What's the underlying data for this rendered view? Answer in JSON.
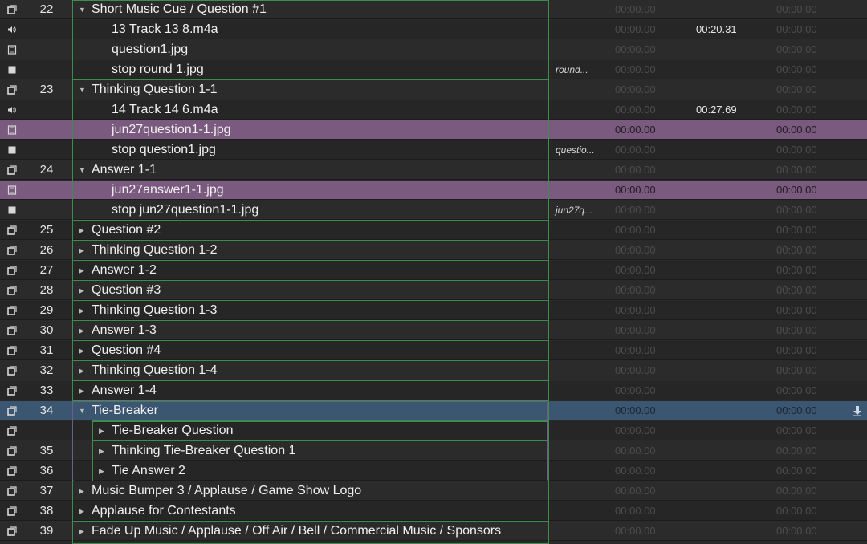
{
  "colors": {
    "row_bg_a": "#2b2b2b",
    "row_bg_b": "#262626",
    "row_purple": "#7a5a7e",
    "row_selected": "#3b5670",
    "group_outline": "#3f8a4c"
  },
  "rows": [
    {
      "icon": "group-icon",
      "num": "22",
      "name": "Short Music Cue / Question #1",
      "level": 0,
      "triangle": "expanded",
      "target": "",
      "t1": "00:00.00",
      "t2": "",
      "t3": "00:00.00",
      "state": ""
    },
    {
      "icon": "audio-icon",
      "num": "",
      "name": "13 Track 13 8.m4a",
      "level": 1,
      "triangle": "",
      "target": "",
      "t1": "00:00.00",
      "t2": "00:20.31",
      "t3": "00:00.00",
      "state": ""
    },
    {
      "icon": "video-icon",
      "num": "",
      "name": "question1.jpg",
      "level": 1,
      "triangle": "",
      "target": "",
      "t1": "00:00.00",
      "t2": "",
      "t3": "00:00.00",
      "state": ""
    },
    {
      "icon": "stop-icon",
      "num": "",
      "name": "stop round 1.jpg",
      "level": 1,
      "triangle": "",
      "target": "round...",
      "t1": "00:00.00",
      "t2": "",
      "t3": "00:00.00",
      "state": ""
    },
    {
      "icon": "group-icon",
      "num": "23",
      "name": "Thinking Question 1-1",
      "level": 0,
      "triangle": "expanded",
      "target": "",
      "t1": "00:00.00",
      "t2": "",
      "t3": "00:00.00",
      "state": ""
    },
    {
      "icon": "audio-icon",
      "num": "",
      "name": "14 Track 14 6.m4a",
      "level": 1,
      "triangle": "",
      "target": "",
      "t1": "00:00.00",
      "t2": "00:27.69",
      "t3": "00:00.00",
      "state": ""
    },
    {
      "icon": "video-icon",
      "num": "",
      "name": "jun27question1-1.jpg",
      "level": 1,
      "triangle": "",
      "target": "",
      "t1": "00:00.00",
      "t2": "",
      "t3": "00:00.00",
      "state": "purple"
    },
    {
      "icon": "stop-icon",
      "num": "",
      "name": "stop question1.jpg",
      "level": 1,
      "triangle": "",
      "target": "questio...",
      "t1": "00:00.00",
      "t2": "",
      "t3": "00:00.00",
      "state": ""
    },
    {
      "icon": "group-icon",
      "num": "24",
      "name": "Answer 1-1",
      "level": 0,
      "triangle": "expanded",
      "target": "",
      "t1": "00:00.00",
      "t2": "",
      "t3": "00:00.00",
      "state": ""
    },
    {
      "icon": "video-icon",
      "num": "",
      "name": "jun27answer1-1.jpg",
      "level": 1,
      "triangle": "",
      "target": "",
      "t1": "00:00.00",
      "t2": "",
      "t3": "00:00.00",
      "state": "purple"
    },
    {
      "icon": "stop-icon",
      "num": "",
      "name": "stop jun27question1-1.jpg",
      "level": 1,
      "triangle": "",
      "target": "jun27q...",
      "t1": "00:00.00",
      "t2": "",
      "t3": "00:00.00",
      "state": ""
    },
    {
      "icon": "group-icon",
      "num": "25",
      "name": "Question #2",
      "level": 0,
      "triangle": "collapsed",
      "target": "",
      "t1": "00:00.00",
      "t2": "",
      "t3": "00:00.00",
      "state": ""
    },
    {
      "icon": "group-icon",
      "num": "26",
      "name": "Thinking Question 1-2",
      "level": 0,
      "triangle": "collapsed",
      "target": "",
      "t1": "00:00.00",
      "t2": "",
      "t3": "00:00.00",
      "state": ""
    },
    {
      "icon": "group-icon",
      "num": "27",
      "name": "Answer 1-2",
      "level": 0,
      "triangle": "collapsed",
      "target": "",
      "t1": "00:00.00",
      "t2": "",
      "t3": "00:00.00",
      "state": ""
    },
    {
      "icon": "group-icon",
      "num": "28",
      "name": "Question #3",
      "level": 0,
      "triangle": "collapsed",
      "target": "",
      "t1": "00:00.00",
      "t2": "",
      "t3": "00:00.00",
      "state": ""
    },
    {
      "icon": "group-icon",
      "num": "29",
      "name": "Thinking Question 1-3",
      "level": 0,
      "triangle": "collapsed",
      "target": "",
      "t1": "00:00.00",
      "t2": "",
      "t3": "00:00.00",
      "state": ""
    },
    {
      "icon": "group-icon",
      "num": "30",
      "name": "Answer 1-3",
      "level": 0,
      "triangle": "collapsed",
      "target": "",
      "t1": "00:00.00",
      "t2": "",
      "t3": "00:00.00",
      "state": ""
    },
    {
      "icon": "group-icon",
      "num": "31",
      "name": "Question #4",
      "level": 0,
      "triangle": "collapsed",
      "target": "",
      "t1": "00:00.00",
      "t2": "",
      "t3": "00:00.00",
      "state": ""
    },
    {
      "icon": "group-icon",
      "num": "32",
      "name": "Thinking Question 1-4",
      "level": 0,
      "triangle": "collapsed",
      "target": "",
      "t1": "00:00.00",
      "t2": "",
      "t3": "00:00.00",
      "state": ""
    },
    {
      "icon": "group-icon",
      "num": "33",
      "name": "Answer 1-4",
      "level": 0,
      "triangle": "collapsed",
      "target": "",
      "t1": "00:00.00",
      "t2": "",
      "t3": "00:00.00",
      "state": ""
    },
    {
      "icon": "group-icon",
      "num": "34",
      "name": "Tie-Breaker",
      "level": 0,
      "triangle": "expanded",
      "target": "",
      "t1": "00:00.00",
      "t2": "",
      "t3": "00:00.00",
      "state": "selected"
    },
    {
      "icon": "group-icon",
      "num": "",
      "name": "Tie-Breaker Question",
      "level": 1,
      "triangle": "collapsed",
      "target": "",
      "t1": "00:00.00",
      "t2": "",
      "t3": "00:00.00",
      "state": ""
    },
    {
      "icon": "group-icon",
      "num": "35",
      "name": "Thinking Tie-Breaker Question 1",
      "level": 1,
      "triangle": "collapsed",
      "target": "",
      "t1": "00:00.00",
      "t2": "",
      "t3": "00:00.00",
      "state": ""
    },
    {
      "icon": "group-icon",
      "num": "36",
      "name": "Tie Answer 2",
      "level": 1,
      "triangle": "collapsed",
      "target": "",
      "t1": "00:00.00",
      "t2": "",
      "t3": "00:00.00",
      "state": ""
    },
    {
      "icon": "group-icon",
      "num": "37",
      "name": "Music Bumper 3 / Applause / Game Show Logo",
      "level": 0,
      "triangle": "collapsed",
      "target": "",
      "t1": "00:00.00",
      "t2": "",
      "t3": "00:00.00",
      "state": ""
    },
    {
      "icon": "group-icon",
      "num": "38",
      "name": "Applause for Contestants",
      "level": 0,
      "triangle": "collapsed",
      "target": "",
      "t1": "00:00.00",
      "t2": "",
      "t3": "00:00.00",
      "state": ""
    },
    {
      "icon": "group-icon",
      "num": "39",
      "name": "Fade Up Music / Applause / Off Air / Bell / Commercial Music / Sponsors",
      "level": 0,
      "triangle": "collapsed",
      "target": "",
      "t1": "00:00.00",
      "t2": "",
      "t3": "00:00.00",
      "state": ""
    }
  ],
  "selected_row_icon": "arrow-down-icon"
}
